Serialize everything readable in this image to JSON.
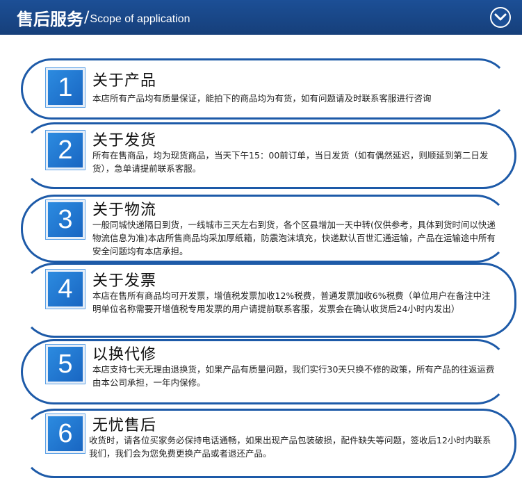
{
  "header": {
    "title_cn": "售后服务",
    "slash": "/",
    "title_en": "Scope of application",
    "toggle_icon": "chevron-down-icon"
  },
  "colors": {
    "header_bg": "#1c4f96",
    "accent": "#1d5aa8",
    "number_box": "#1966c2"
  },
  "sections": [
    {
      "number": "1",
      "title": "关于产品",
      "text": "本店所有产品均有质量保证，能拍下的商品均为有货，如有问题请及时联系客服进行咨询"
    },
    {
      "number": "2",
      "title": "关于发货",
      "text": "所有在售商品，均为现货商品，当天下午15：00前订单，当日发货（如有偶然延迟，则顺延到第二日发货），急单请提前联系客服。"
    },
    {
      "number": "3",
      "title": "关于物流",
      "text": "一般同城快递隔日到货，一线城市三天左右到货，各个区县增加一天中转(仅供参考，具体到货时间以快递物流信息为准)本店所售商品均采加厚纸箱，防震泡沫填充，快递默认百世汇通运输，产品在运输途中所有安全问题均有本店承担。"
    },
    {
      "number": "4",
      "title": "关于发票",
      "text": "本店在售所有商品均可开发票，增值税发票加收12%税费，普通发票加收6%税费（单位用户在备注中注明单位名称需要开增值税专用发票的用户请提前联系客服，发票会在确认收货后24小时内发出）"
    },
    {
      "number": "5",
      "title": "以换代修",
      "text": "本店支持七天无理由退换货，如果产品有质量问题，我们实行30天只换不修的政策，所有产品的往返运费由本公司承担，一年内保修。"
    },
    {
      "number": "6",
      "title": "无忧售后",
      "text": "收货时，请各位买家务必保持电话通畅，如果出现产品包装破损，配件缺失等问题，签收后12小时内联系我们，我们会为您免费更换产品或者退还产品。"
    }
  ]
}
